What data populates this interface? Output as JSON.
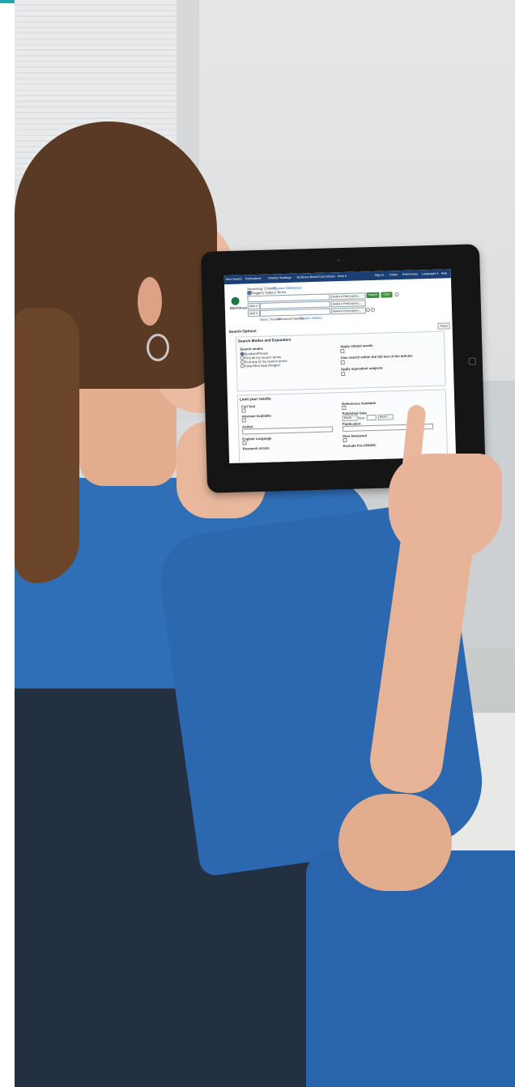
{
  "tablet_ui": {
    "nav": [
      "New Search",
      "Publications",
      "CINAHL Headings",
      "Evidence-Based Care Sheets",
      "More ▾"
    ],
    "nav_right": [
      "Sign In",
      "Folder",
      "Preferences",
      "Languages ▾",
      "Help"
    ],
    "searching_label": "Searching: CINAHL",
    "choose_databases": "Choose Databases",
    "suggest_terms": "Suggest Subject Terms",
    "logo_text": "EBSCOhost",
    "field_select": "Select a Field (option...",
    "bool_and": "AND ▾",
    "search_btn": "Search",
    "clear_btn": "Clear",
    "search_links": [
      "Basic Search",
      "Advanced Search",
      "Search History"
    ],
    "search_options_title": "Search Options",
    "reset_btn": "Reset",
    "modes_title": "Search Modes and Expanders",
    "search_modes_label": "Search modes",
    "modes": [
      "Boolean/Phrase",
      "Find all my search terms",
      "Find any of my search terms",
      "SmartText Searching"
    ],
    "smarttext_hint": "Hint",
    "related_words": "Apply related words",
    "full_text_within": "Also search within the full text of the articles",
    "equiv_subjects": "Apply equivalent subjects",
    "limit_title": "Limit your results",
    "limits_left": [
      "Full Text",
      "Abstract Available",
      "Author",
      "English Language",
      "Research Article"
    ],
    "limits_right": [
      "References Available",
      "Published Date",
      "Publication",
      "Peer Reviewed",
      "Exclude Pre-CINAHL"
    ],
    "month_label": "Month",
    "year_label": "Year"
  }
}
